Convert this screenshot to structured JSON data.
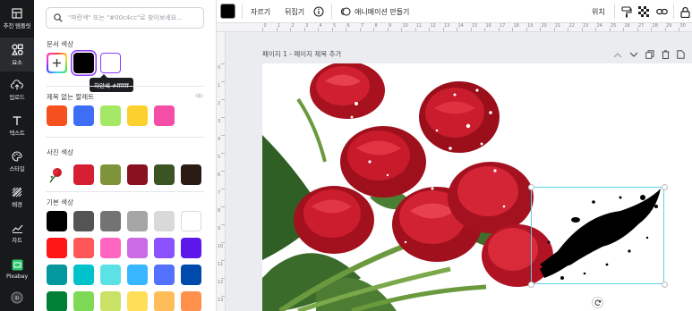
{
  "rail": {
    "items": [
      {
        "label": "추천 템플릿",
        "icon": "layout-icon"
      },
      {
        "label": "요소",
        "icon": "shapes-icon"
      },
      {
        "label": "업로드",
        "icon": "upload-cloud-icon"
      },
      {
        "label": "텍스트",
        "icon": "text-icon"
      },
      {
        "label": "스타일",
        "icon": "palette-icon"
      },
      {
        "label": "배경",
        "icon": "pattern-icon"
      },
      {
        "label": "차트",
        "icon": "chart-icon"
      },
      {
        "label": "Pixabay",
        "icon": "pixabay-icon"
      },
      {
        "label": "",
        "icon": "app-icon"
      }
    ]
  },
  "panel": {
    "search_placeholder": "\"파란색\" 또는 \"#00c4cc\"로 찾아보세요...",
    "doc_colors_title": "문서 색상",
    "doc_colors": [
      "#000000",
      "#ffffff"
    ],
    "tooltip": "하얀색 #ffffff",
    "palette_title": "제목 없는 팔레트",
    "palette_colors": [
      "#f4511e",
      "#3d6ef5",
      "#a4e865",
      "#fdd12d",
      "#f54ea8"
    ],
    "photo_colors_title": "사진 색상",
    "photo_colors": [
      "#d61f32",
      "#7f943a",
      "#8a1220",
      "#3b5423",
      "#2a1c15"
    ],
    "default_colors_title": "기본 색상",
    "default_colors": [
      [
        "#000000",
        "#545454",
        "#737373",
        "#a6a6a6",
        "#d9d9d9",
        "#ffffff"
      ],
      [
        "#ff1616",
        "#ff5757",
        "#ff66c4",
        "#cb6ce6",
        "#8c52ff",
        "#5e17eb"
      ],
      [
        "#03989e",
        "#00c2cb",
        "#5ce1e6",
        "#38b6ff",
        "#5271ff",
        "#004aad"
      ],
      [
        "#008037",
        "#7ed957",
        "#c9e265",
        "#ffde59",
        "#ffbd59",
        "#ff914d"
      ]
    ]
  },
  "toolbar": {
    "color": "#000000",
    "crop_label": "자르기",
    "flip_label": "뒤집기",
    "info_icon": "info-icon",
    "animate_label": "애니메이션 만들기",
    "position_label": "위치"
  },
  "page": {
    "title": "페이지 1 - 페이지 제목 추가"
  },
  "ruler": {
    "top_numbers": [
      "0",
      "1",
      "2",
      "3",
      "4",
      "5",
      "6",
      "7",
      "8",
      "9",
      "10",
      "11",
      "12",
      "13",
      "14",
      "15",
      "16",
      "17",
      "18",
      "19",
      "20",
      "21",
      "22",
      "23",
      "24",
      "25",
      "26",
      "27",
      "28",
      "29",
      "30",
      "31",
      "32"
    ],
    "left_numbers": [
      "0",
      "1",
      "2",
      "3",
      "4",
      "5",
      "6",
      "7",
      "8",
      "9",
      "10",
      "11",
      "12",
      "13"
    ]
  },
  "colors": {
    "selection": "#5cd3e6",
    "rose_red": "#d61f32",
    "leaf_green": "#3b6b2b"
  }
}
